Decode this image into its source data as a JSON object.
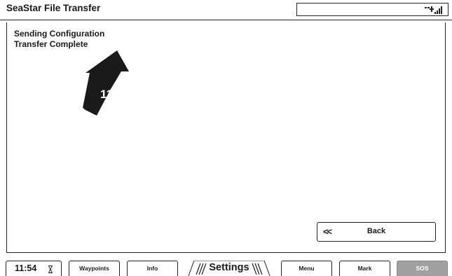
{
  "header": {
    "title": "SeaStar File Transfer",
    "status_icon": "signal-strength-icon"
  },
  "main": {
    "line1": "Sending Configuration",
    "line2": "Transfer Complete",
    "callout_number": "11",
    "back_chevron": "<<",
    "back_label": "Back"
  },
  "softkeys": {
    "time": "11:54",
    "waypoints": "Waypoints",
    "info": "Info",
    "settings": "Settings",
    "menu": "Menu",
    "mark": "Mark",
    "sos": "SOS"
  },
  "colors": {
    "ink": "#1a1a1a",
    "sos_fill": "#a0a0a0",
    "callout_fill": "#1a1a1a"
  }
}
